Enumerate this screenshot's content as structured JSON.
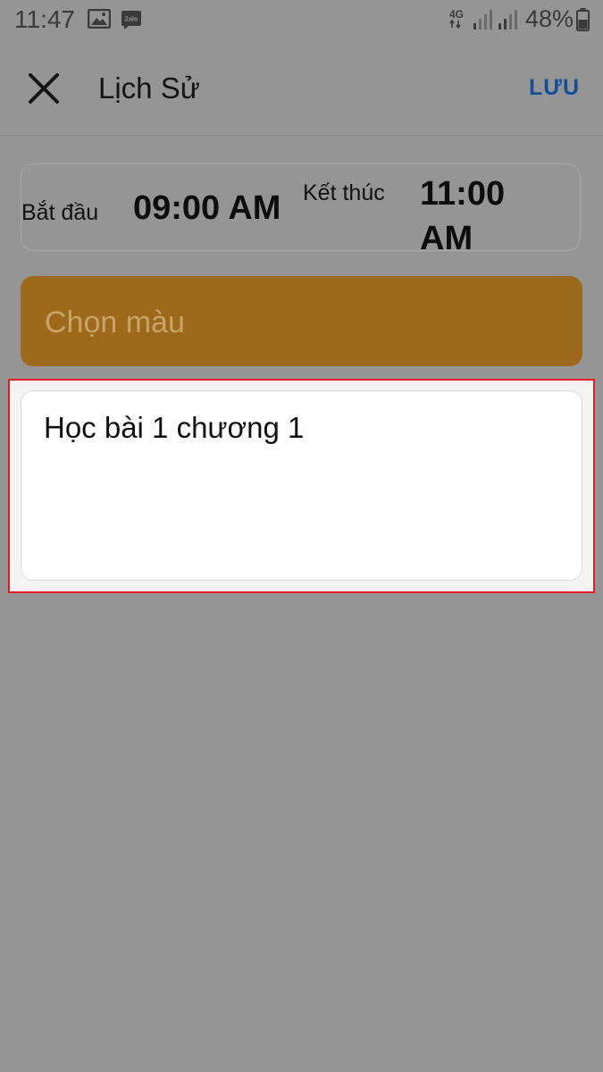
{
  "status_bar": {
    "time": "11:47",
    "notification_icons": [
      "gallery-icon",
      "zalo-icon"
    ],
    "zalo_label": "Zalo",
    "network": "4G",
    "battery": "48%"
  },
  "app_bar": {
    "close_icon": "close-icon",
    "title": "Lịch Sử",
    "save_label": "LƯU"
  },
  "schedule": {
    "start_label": "Bắt đầu",
    "start_time": "09:00 AM",
    "end_label": "Kết thúc",
    "end_time": "11:00 AM"
  },
  "color_picker": {
    "label": "Chọn màu",
    "color": "#9c6a1a"
  },
  "note": {
    "value": "Học bài 1 chương 1"
  },
  "colors": {
    "background": "#959595",
    "accent": "#124f98",
    "highlight": "#e41c23"
  }
}
